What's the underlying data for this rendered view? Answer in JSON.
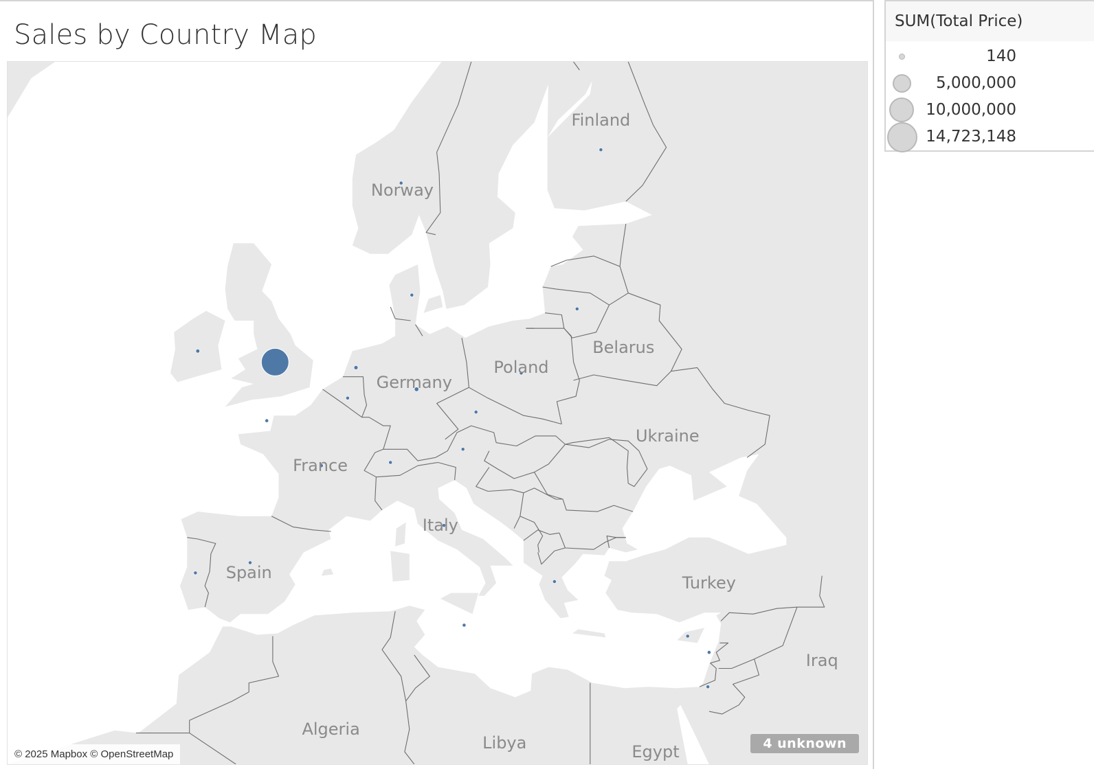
{
  "title": "Sales by Country Map",
  "map": {
    "attribution": "© 2025 Mapbox © OpenStreetMap",
    "unknown_badge": "4 unknown",
    "country_labels": [
      {
        "name": "Finland"
      },
      {
        "name": "Norway"
      },
      {
        "name": "Belarus"
      },
      {
        "name": "Poland"
      },
      {
        "name": "Germany"
      },
      {
        "name": "Ukraine"
      },
      {
        "name": "France"
      },
      {
        "name": "Italy"
      },
      {
        "name": "Spain"
      },
      {
        "name": "Turkey"
      },
      {
        "name": "Iraq"
      },
      {
        "name": "Algeria"
      },
      {
        "name": "Libya"
      },
      {
        "name": "Egypt"
      }
    ],
    "colors": {
      "land": "#e8e8e8",
      "water": "#ffffff",
      "border": "#6e6e6e",
      "mark": "#4e79a7"
    }
  },
  "chart_data": {
    "type": "scatter",
    "measure": "SUM(Total Price)",
    "legend": {
      "title": "SUM(Total Price)",
      "entries": [
        {
          "label": "140",
          "value": 140
        },
        {
          "label": "5,000,000",
          "value": 5000000
        },
        {
          "label": "10,000,000",
          "value": 10000000
        },
        {
          "label": "14,723,148",
          "value": 14723148
        }
      ],
      "placement": "right"
    },
    "points": [
      {
        "lon": -1.5,
        "lat": 52.6,
        "value": 14723148
      },
      {
        "lon": -8.0,
        "lat": 53.2,
        "value": 280000
      },
      {
        "lon": 5.3,
        "lat": 52.3,
        "value": 300000
      },
      {
        "lon": 10.4,
        "lat": 51.1,
        "value": 380000
      },
      {
        "lon": 2.4,
        "lat": 46.6,
        "value": 250000
      },
      {
        "lon": 4.6,
        "lat": 50.6,
        "value": 60000
      },
      {
        "lon": -2.2,
        "lat": 49.3,
        "value": 40000
      },
      {
        "lon": 10.0,
        "lat": 56.1,
        "value": 20000
      },
      {
        "lon": 9.1,
        "lat": 61.3,
        "value": 5000
      },
      {
        "lon": 25.9,
        "lat": 62.7,
        "value": 8000
      },
      {
        "lon": 23.9,
        "lat": 55.4,
        "value": 8000
      },
      {
        "lon": 19.2,
        "lat": 52.0,
        "value": 8000
      },
      {
        "lon": 15.4,
        "lat": 49.8,
        "value": 20000
      },
      {
        "lon": 14.3,
        "lat": 47.6,
        "value": 20000
      },
      {
        "lon": 8.2,
        "lat": 46.8,
        "value": 15000
      },
      {
        "lon": 12.7,
        "lat": 42.8,
        "value": 15000
      },
      {
        "lon": -8.2,
        "lat": 39.6,
        "value": 10000
      },
      {
        "lon": -3.6,
        "lat": 40.3,
        "value": 10000
      },
      {
        "lon": 22.0,
        "lat": 39.0,
        "value": 15000
      },
      {
        "lon": 14.4,
        "lat": 35.9,
        "value": 20000
      },
      {
        "lon": 33.2,
        "lat": 35.1,
        "value": 10000
      },
      {
        "lon": 35.0,
        "lat": 33.9,
        "value": 10000
      },
      {
        "lon": 34.9,
        "lat": 31.3,
        "value": 10000
      }
    ]
  }
}
